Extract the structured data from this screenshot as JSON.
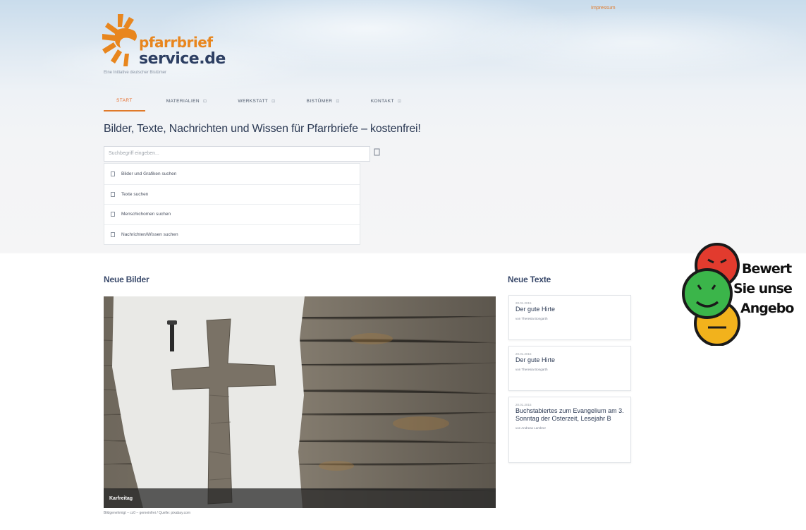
{
  "header": {
    "top_link": "Impressum",
    "logo": {
      "word1": "pfarrbrief",
      "word2": "service.de",
      "tagline": "Eine Initiative deutscher Bistümer"
    }
  },
  "nav": {
    "items": [
      {
        "label": "START",
        "active": true
      },
      {
        "label": "MATERIALIEN",
        "active": false
      },
      {
        "label": "WERKSTATT",
        "active": false
      },
      {
        "label": "BISTÜMER",
        "active": false
      },
      {
        "label": "KONTAKT",
        "active": false
      }
    ],
    "arrow": "⊡"
  },
  "main": {
    "title": "Bilder, Texte, Nachrichten und Wissen für Pfarrbriefe – kostenfrei!",
    "search": {
      "placeholder": "Suchbegriff eingeben..."
    },
    "search_options": [
      "Bilder und Grafiken suchen",
      "Texte suchen",
      "Menschichomen suchen",
      "Nachrichten/Wissen suchen"
    ]
  },
  "images": {
    "heading": "Neue Bilder",
    "caption": "Karfreitag",
    "copyright": "Bildgenehmigt – cc0 – gemeinfrei / Quelle: pixabay.com"
  },
  "texts": {
    "heading": "Neue Texte",
    "cards": [
      {
        "date": "20.01.2015",
        "title": "Der gute Hirte",
        "author": "von Theresia Bongarth"
      },
      {
        "date": "20.01.2015",
        "title": "Der gute Hirte",
        "author": "von Theresia Bongarth"
      },
      {
        "date": "20.01.2015",
        "title": "Buchstabiertes zum Evangelium am 3. Sonntag der Osterzeit, Lesejahr B",
        "author": "von Andreas Lambrer"
      }
    ]
  },
  "rating": {
    "line1": "Bewert",
    "line2": "Sie unse",
    "line3": "Angebo"
  },
  "colors": {
    "accent": "#e07a2a",
    "brand_blue": "#2d3f63",
    "smiley_red": "#e23b2e",
    "smiley_green": "#3bb54a",
    "smiley_yellow": "#f2b21c"
  }
}
